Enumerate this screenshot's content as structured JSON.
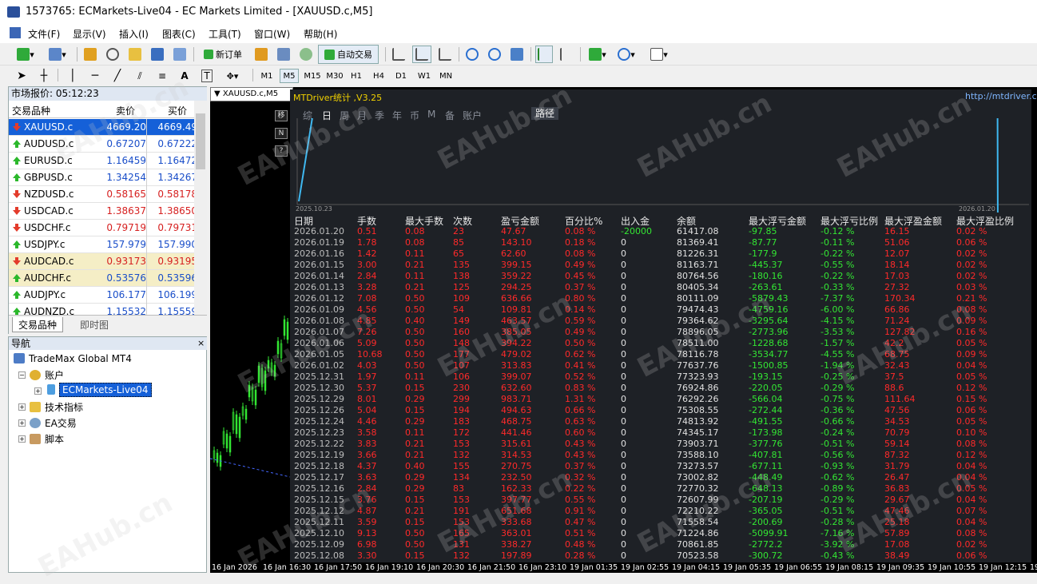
{
  "window": {
    "title": "1573765: ECMarkets-Live04 - EC Markets Limited - [XAUUSD.c,M5]"
  },
  "menu": [
    "文件(F)",
    "显示(V)",
    "插入(I)",
    "图表(C)",
    "工具(T)",
    "窗口(W)",
    "帮助(H)"
  ],
  "toolbar": {
    "new_order": "新订单",
    "auto_trade": "自动交易"
  },
  "periods": [
    "M1",
    "M5",
    "M15",
    "M30",
    "H1",
    "H4",
    "D1",
    "W1",
    "MN"
  ],
  "market_watch": {
    "title": "市场报价: 05:12:23",
    "col_symbol": "交易品种",
    "col_bid": "卖价",
    "col_ask": "买价",
    "rows": [
      {
        "sym": "XAUUSD.c",
        "bid": "4669.20",
        "ask": "4669.49",
        "dir": "down"
      },
      {
        "sym": "AUDUSD.c",
        "bid": "0.67207",
        "ask": "0.67222",
        "dir": "up"
      },
      {
        "sym": "EURUSD.c",
        "bid": "1.16459",
        "ask": "1.16472",
        "dir": "up"
      },
      {
        "sym": "GBPUSD.c",
        "bid": "1.34254",
        "ask": "1.34267",
        "dir": "up"
      },
      {
        "sym": "NZDUSD.c",
        "bid": "0.58165",
        "ask": "0.58178",
        "dir": "down"
      },
      {
        "sym": "USDCAD.c",
        "bid": "1.38637",
        "ask": "1.38650",
        "dir": "down"
      },
      {
        "sym": "USDCHF.c",
        "bid": "0.79719",
        "ask": "0.79731",
        "dir": "down"
      },
      {
        "sym": "USDJPY.c",
        "bid": "157.979",
        "ask": "157.990",
        "dir": "up"
      },
      {
        "sym": "AUDCAD.c",
        "bid": "0.93173",
        "ask": "0.93195",
        "dir": "down"
      },
      {
        "sym": "AUDCHF.c",
        "bid": "0.53576",
        "ask": "0.53596",
        "dir": "up"
      },
      {
        "sym": "AUDJPY.c",
        "bid": "106.177",
        "ask": "106.199",
        "dir": "up"
      },
      {
        "sym": "AUDNZD.c",
        "bid": "1.15532",
        "ask": "1.15559",
        "dir": "up"
      }
    ],
    "tab_symbols": "交易品种",
    "tab_tick": "即时图"
  },
  "navigator": {
    "title": "导航",
    "root": "TradeMax Global MT4",
    "accounts": "账户",
    "account": "ECMarkets-Live04",
    "indicators": "技术指标",
    "ea": "EA交易",
    "scripts": "脚本"
  },
  "chart": {
    "label": "XAUUSD.c,M5"
  },
  "dashboard": {
    "title": "MTDriver统计 ,V3.25",
    "url": "http://mtdriver.cn",
    "tabs": [
      "综",
      "日",
      "周",
      "月",
      "季",
      "年",
      "币",
      "M",
      "备",
      "账户",
      "路径"
    ],
    "side_buttons": [
      "移",
      "N",
      "?"
    ],
    "eq_start": "2025.10.23",
    "eq_end": "2026.01.20",
    "headers": [
      "日期",
      "手数",
      "最大手数",
      "次数",
      "盈亏金额",
      "百分比%",
      "出入金",
      "余额",
      "最大浮亏金额",
      "最大浮亏比例",
      "最大浮盈金额",
      "最大浮盈比例"
    ],
    "rows": [
      [
        "2026.01.20",
        "0.51",
        "0.08",
        "23",
        "47.67",
        "0.08 %",
        "-20000",
        "61417.08",
        "-97.85",
        "-0.12 %",
        "16.15",
        "0.02 %"
      ],
      [
        "2026.01.19",
        "1.78",
        "0.08",
        "85",
        "143.10",
        "0.18 %",
        "0",
        "81369.41",
        "-87.77",
        "-0.11 %",
        "51.06",
        "0.06 %"
      ],
      [
        "2026.01.16",
        "1.42",
        "0.11",
        "65",
        "62.60",
        "0.08 %",
        "0",
        "81226.31",
        "-177.9",
        "-0.22 %",
        "12.07",
        "0.02 %"
      ],
      [
        "2026.01.15",
        "3.00",
        "0.21",
        "135",
        "399.15",
        "0.49 %",
        "0",
        "81163.71",
        "-445.37",
        "-0.55 %",
        "18.14",
        "0.02 %"
      ],
      [
        "2026.01.14",
        "2.84",
        "0.11",
        "138",
        "359.22",
        "0.45 %",
        "0",
        "80764.56",
        "-180.16",
        "-0.22 %",
        "17.03",
        "0.02 %"
      ],
      [
        "2026.01.13",
        "3.28",
        "0.21",
        "125",
        "294.25",
        "0.37 %",
        "0",
        "80405.34",
        "-263.61",
        "-0.33 %",
        "27.32",
        "0.03 %"
      ],
      [
        "2026.01.12",
        "7.08",
        "0.50",
        "109",
        "636.66",
        "0.80 %",
        "0",
        "80111.09",
        "-5879.43",
        "-7.37 %",
        "170.34",
        "0.21 %"
      ],
      [
        "2026.01.09",
        "4.56",
        "0.50",
        "54",
        "109.81",
        "0.14 %",
        "0",
        "79474.43",
        "-4759.16",
        "-6.00 %",
        "66.86",
        "0.08 %"
      ],
      [
        "2026.01.08",
        "4.85",
        "0.40",
        "149",
        "463.57",
        "0.59 %",
        "0",
        "79364.62",
        "-3295.64",
        "-4.15 %",
        "71.24",
        "0.09 %"
      ],
      [
        "2026.01.07",
        "7.26",
        "0.50",
        "160",
        "385.05",
        "0.49 %",
        "0",
        "78896.05",
        "-2773.96",
        "-3.53 %",
        "127.82",
        "0.16 %"
      ],
      [
        "2026.01.06",
        "5.09",
        "0.50",
        "148",
        "394.22",
        "0.50 %",
        "0",
        "78511.00",
        "-1228.68",
        "-1.57 %",
        "42.2",
        "0.05 %"
      ],
      [
        "2026.01.05",
        "10.68",
        "0.50",
        "177",
        "479.02",
        "0.62 %",
        "0",
        "78116.78",
        "-3534.77",
        "-4.55 %",
        "68.75",
        "0.09 %"
      ],
      [
        "2026.01.02",
        "4.03",
        "0.50",
        "107",
        "313.83",
        "0.41 %",
        "0",
        "77637.76",
        "-1500.85",
        "-1.94 %",
        "32.43",
        "0.04 %"
      ],
      [
        "2025.12.31",
        "1.97",
        "0.11",
        "106",
        "399.07",
        "0.52 %",
        "0",
        "77323.93",
        "-193.15",
        "-0.25 %",
        "37.5",
        "0.05 %"
      ],
      [
        "2025.12.30",
        "5.37",
        "0.15",
        "230",
        "632.60",
        "0.83 %",
        "0",
        "76924.86",
        "-220.05",
        "-0.29 %",
        "88.6",
        "0.12 %"
      ],
      [
        "2025.12.29",
        "8.01",
        "0.29",
        "299",
        "983.71",
        "1.31 %",
        "0",
        "76292.26",
        "-566.04",
        "-0.75 %",
        "111.64",
        "0.15 %"
      ],
      [
        "2025.12.26",
        "5.04",
        "0.15",
        "194",
        "494.63",
        "0.66 %",
        "0",
        "75308.55",
        "-272.44",
        "-0.36 %",
        "47.56",
        "0.06 %"
      ],
      [
        "2025.12.24",
        "4.46",
        "0.29",
        "183",
        "468.75",
        "0.63 %",
        "0",
        "74813.92",
        "-491.55",
        "-0.66 %",
        "34.53",
        "0.05 %"
      ],
      [
        "2025.12.23",
        "3.58",
        "0.11",
        "172",
        "441.46",
        "0.60 %",
        "0",
        "74345.17",
        "-173.98",
        "-0.24 %",
        "70.79",
        "0.10 %"
      ],
      [
        "2025.12.22",
        "3.83",
        "0.21",
        "153",
        "315.61",
        "0.43 %",
        "0",
        "73903.71",
        "-377.76",
        "-0.51 %",
        "59.14",
        "0.08 %"
      ],
      [
        "2025.12.19",
        "3.66",
        "0.21",
        "132",
        "314.53",
        "0.43 %",
        "0",
        "73588.10",
        "-407.81",
        "-0.56 %",
        "87.32",
        "0.12 %"
      ],
      [
        "2025.12.18",
        "4.37",
        "0.40",
        "155",
        "270.75",
        "0.37 %",
        "0",
        "73273.57",
        "-677.11",
        "-0.93 %",
        "31.79",
        "0.04 %"
      ],
      [
        "2025.12.17",
        "3.63",
        "0.29",
        "134",
        "232.50",
        "0.32 %",
        "0",
        "73002.82",
        "-448.49",
        "-0.62 %",
        "26.47",
        "0.04 %"
      ],
      [
        "2025.12.16",
        "2.84",
        "0.29",
        "83",
        "162.33",
        "0.22 %",
        "0",
        "72770.32",
        "-648.13",
        "-0.89 %",
        "36.83",
        "0.05 %"
      ],
      [
        "2025.12.15",
        "3.76",
        "0.15",
        "153",
        "397.77",
        "0.55 %",
        "0",
        "72607.99",
        "-207.19",
        "-0.29 %",
        "29.67",
        "0.04 %"
      ],
      [
        "2025.12.12",
        "4.87",
        "0.21",
        "191",
        "651.68",
        "0.91 %",
        "0",
        "72210.22",
        "-365.05",
        "-0.51 %",
        "47.46",
        "0.07 %"
      ],
      [
        "2025.12.11",
        "3.59",
        "0.15",
        "153",
        "333.68",
        "0.47 %",
        "0",
        "71558.54",
        "-200.69",
        "-0.28 %",
        "25.18",
        "0.04 %"
      ],
      [
        "2025.12.10",
        "9.13",
        "0.50",
        "165",
        "363.01",
        "0.51 %",
        "0",
        "71224.86",
        "-5099.91",
        "-7.16 %",
        "57.89",
        "0.08 %"
      ],
      [
        "2025.12.09",
        "6.98",
        "0.50",
        "131",
        "338.27",
        "0.48 %",
        "0",
        "70861.85",
        "-2772.2",
        "-3.92 %",
        "17.08",
        "0.02 %"
      ],
      [
        "2025.12.08",
        "3.30",
        "0.15",
        "132",
        "197.89",
        "0.28 %",
        "0",
        "70523.58",
        "-300.72",
        "-0.43 %",
        "38.49",
        "0.06 %"
      ]
    ]
  },
  "xaxis": [
    "16 Jan 2026",
    "16 Jan 16:30",
    "16 Jan 17:50",
    "16 Jan 19:10",
    "16 Jan 20:30",
    "16 Jan 21:50",
    "16 Jan 23:10",
    "19 Jan 01:35",
    "19 Jan 02:55",
    "19 Jan 04:15",
    "19 Jan 05:35",
    "19 Jan 06:55",
    "19 Jan 08:15",
    "19 Jan 09:35",
    "19 Jan 10:55",
    "19 Jan 12:15",
    "19"
  ],
  "watermark": "EAHub.cn",
  "colors": {
    "profit": "#ff2a2a",
    "loss": "#33e633",
    "text": "#e0e0e0",
    "equity": "#3fb8f0",
    "selected": "#1560d8"
  }
}
